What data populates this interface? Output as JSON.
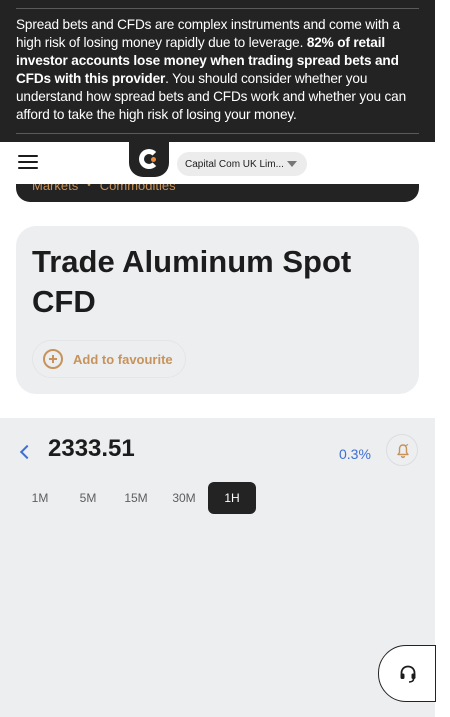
{
  "risk_warning": {
    "part1": "Spread bets and CFDs are complex instruments and come with a high risk of losing money rapidly due to leverage. ",
    "bold": "82% of retail investor accounts lose money when trading spread bets and CFDs with this provider",
    "part2": ". You should consider whether you understand how spread bets and CFDs work and whether you can afford to take the high risk of losing your money."
  },
  "header": {
    "menu_icon": "hamburger-menu-icon",
    "logo_icon": "capital-com-logo",
    "entity_select": "Capital Com UK Lim..."
  },
  "breadcrumb": {
    "items": [
      "Markets",
      "Commodities"
    ],
    "separator": "•"
  },
  "instrument": {
    "title": "Trade Aluminum Spot CFD",
    "favourite_label": "Add to favourite"
  },
  "chart": {
    "price": "2333.51",
    "change": "0.3%",
    "timeframes": [
      "1M",
      "5M",
      "15M",
      "30M",
      "1H"
    ],
    "selected_timeframe": "1H"
  },
  "colors": {
    "dark": "#232323",
    "accent": "#c8935a",
    "link_blue": "#3f6fd1",
    "panel": "#eceef0"
  }
}
